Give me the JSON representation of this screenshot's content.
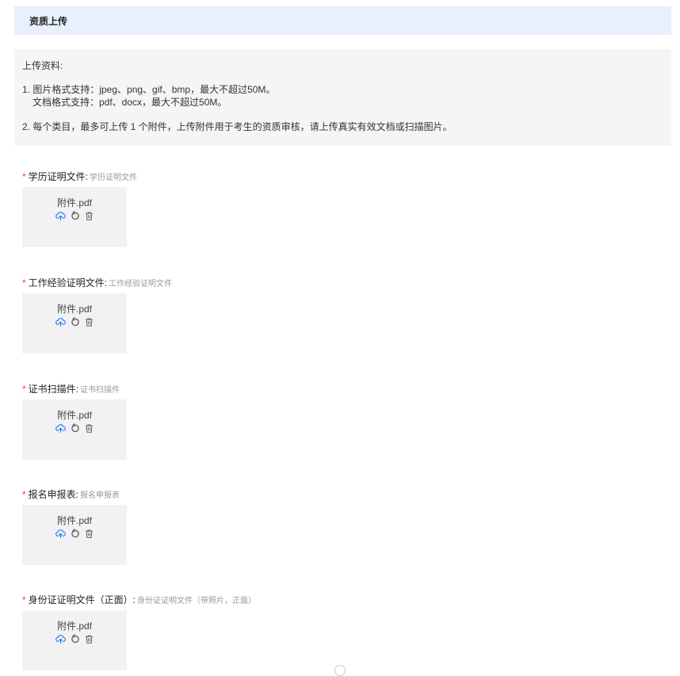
{
  "header": {
    "title": "资质上传"
  },
  "notice": {
    "heading": "上传资料:",
    "line1": "1. 图片格式支持：jpeg、png、gif、bmp，最大不超过50M。",
    "line2": "文档格式支持：pdf、docx，最大不超过50M。",
    "line3": "2. 每个类目，最多可上传 1 个附件，上传附件用于考生的资质审核，请上传真实有效文档或扫描图片。"
  },
  "sections": [
    {
      "required": "*",
      "label": "学历证明文件:",
      "hint": "学历证明文件",
      "file": "附件.pdf"
    },
    {
      "required": "*",
      "label": "工作经验证明文件:",
      "hint": "工作经验证明文件",
      "file": "附件.pdf"
    },
    {
      "required": "*",
      "label": "证书扫描件:",
      "hint": "证书扫描件",
      "file": "附件.pdf"
    },
    {
      "required": "*",
      "label": "报名申报表:",
      "hint": "报名申报表",
      "file": "附件.pdf"
    },
    {
      "required": "*",
      "label": "身份证证明文件（正面）:",
      "hint": "身份证证明文件（带照片，正面）",
      "file": "附件.pdf"
    }
  ],
  "icons": {
    "upload": "cloud-upload-icon",
    "replace": "rotate-icon",
    "delete": "trash-icon"
  },
  "colors": {
    "accent": "#1677ff",
    "required": "#e54545",
    "header_bg": "#e8f0fb",
    "card_bg": "#f2f2f2"
  }
}
